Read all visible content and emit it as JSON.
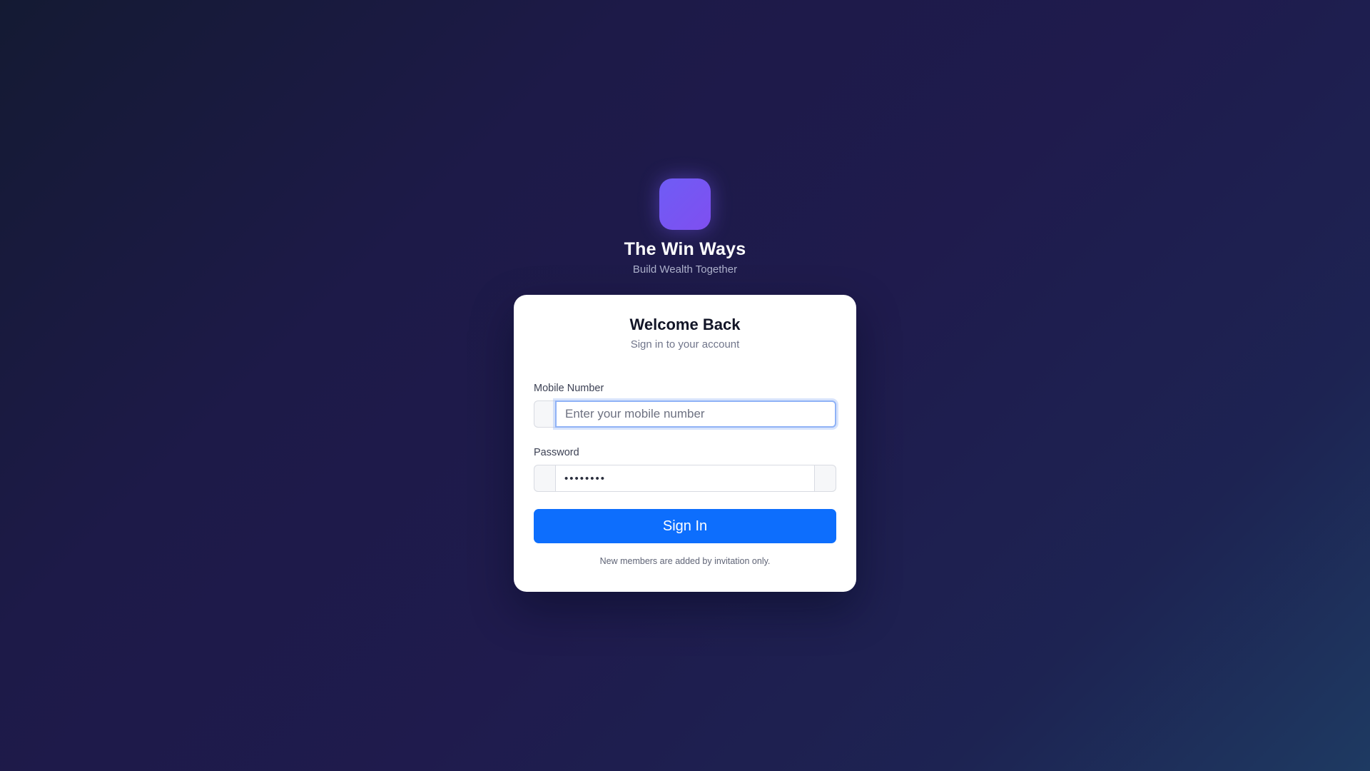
{
  "brand": {
    "title": "The Win Ways",
    "subtitle": "Build Wealth Together",
    "logo_color": "#7259f4"
  },
  "login": {
    "title": "Welcome Back",
    "subtitle": "Sign in to your account",
    "mobile": {
      "label": "Mobile Number",
      "placeholder": "Enter your mobile number",
      "value": ""
    },
    "password": {
      "label": "Password",
      "value": "••••••••"
    },
    "submit_label": "Sign In",
    "footnote": "New members are added by invitation only."
  },
  "colors": {
    "primary": "#0d6efd",
    "focus_ring": "#8fb2f6"
  }
}
